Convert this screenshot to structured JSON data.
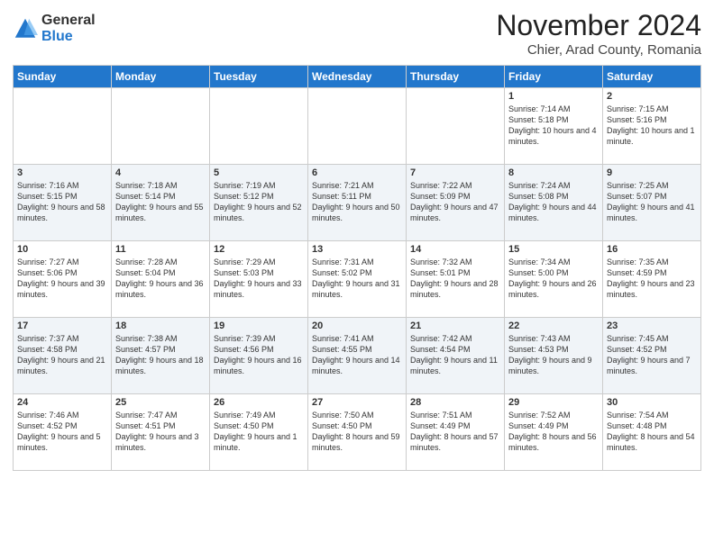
{
  "logo": {
    "general": "General",
    "blue": "Blue"
  },
  "title": "November 2024",
  "subtitle": "Chier, Arad County, Romania",
  "headers": [
    "Sunday",
    "Monday",
    "Tuesday",
    "Wednesday",
    "Thursday",
    "Friday",
    "Saturday"
  ],
  "weeks": [
    [
      {
        "day": "",
        "info": ""
      },
      {
        "day": "",
        "info": ""
      },
      {
        "day": "",
        "info": ""
      },
      {
        "day": "",
        "info": ""
      },
      {
        "day": "",
        "info": ""
      },
      {
        "day": "1",
        "info": "Sunrise: 7:14 AM\nSunset: 5:18 PM\nDaylight: 10 hours and 4 minutes."
      },
      {
        "day": "2",
        "info": "Sunrise: 7:15 AM\nSunset: 5:16 PM\nDaylight: 10 hours and 1 minute."
      }
    ],
    [
      {
        "day": "3",
        "info": "Sunrise: 7:16 AM\nSunset: 5:15 PM\nDaylight: 9 hours and 58 minutes."
      },
      {
        "day": "4",
        "info": "Sunrise: 7:18 AM\nSunset: 5:14 PM\nDaylight: 9 hours and 55 minutes."
      },
      {
        "day": "5",
        "info": "Sunrise: 7:19 AM\nSunset: 5:12 PM\nDaylight: 9 hours and 52 minutes."
      },
      {
        "day": "6",
        "info": "Sunrise: 7:21 AM\nSunset: 5:11 PM\nDaylight: 9 hours and 50 minutes."
      },
      {
        "day": "7",
        "info": "Sunrise: 7:22 AM\nSunset: 5:09 PM\nDaylight: 9 hours and 47 minutes."
      },
      {
        "day": "8",
        "info": "Sunrise: 7:24 AM\nSunset: 5:08 PM\nDaylight: 9 hours and 44 minutes."
      },
      {
        "day": "9",
        "info": "Sunrise: 7:25 AM\nSunset: 5:07 PM\nDaylight: 9 hours and 41 minutes."
      }
    ],
    [
      {
        "day": "10",
        "info": "Sunrise: 7:27 AM\nSunset: 5:06 PM\nDaylight: 9 hours and 39 minutes."
      },
      {
        "day": "11",
        "info": "Sunrise: 7:28 AM\nSunset: 5:04 PM\nDaylight: 9 hours and 36 minutes."
      },
      {
        "day": "12",
        "info": "Sunrise: 7:29 AM\nSunset: 5:03 PM\nDaylight: 9 hours and 33 minutes."
      },
      {
        "day": "13",
        "info": "Sunrise: 7:31 AM\nSunset: 5:02 PM\nDaylight: 9 hours and 31 minutes."
      },
      {
        "day": "14",
        "info": "Sunrise: 7:32 AM\nSunset: 5:01 PM\nDaylight: 9 hours and 28 minutes."
      },
      {
        "day": "15",
        "info": "Sunrise: 7:34 AM\nSunset: 5:00 PM\nDaylight: 9 hours and 26 minutes."
      },
      {
        "day": "16",
        "info": "Sunrise: 7:35 AM\nSunset: 4:59 PM\nDaylight: 9 hours and 23 minutes."
      }
    ],
    [
      {
        "day": "17",
        "info": "Sunrise: 7:37 AM\nSunset: 4:58 PM\nDaylight: 9 hours and 21 minutes."
      },
      {
        "day": "18",
        "info": "Sunrise: 7:38 AM\nSunset: 4:57 PM\nDaylight: 9 hours and 18 minutes."
      },
      {
        "day": "19",
        "info": "Sunrise: 7:39 AM\nSunset: 4:56 PM\nDaylight: 9 hours and 16 minutes."
      },
      {
        "day": "20",
        "info": "Sunrise: 7:41 AM\nSunset: 4:55 PM\nDaylight: 9 hours and 14 minutes."
      },
      {
        "day": "21",
        "info": "Sunrise: 7:42 AM\nSunset: 4:54 PM\nDaylight: 9 hours and 11 minutes."
      },
      {
        "day": "22",
        "info": "Sunrise: 7:43 AM\nSunset: 4:53 PM\nDaylight: 9 hours and 9 minutes."
      },
      {
        "day": "23",
        "info": "Sunrise: 7:45 AM\nSunset: 4:52 PM\nDaylight: 9 hours and 7 minutes."
      }
    ],
    [
      {
        "day": "24",
        "info": "Sunrise: 7:46 AM\nSunset: 4:52 PM\nDaylight: 9 hours and 5 minutes."
      },
      {
        "day": "25",
        "info": "Sunrise: 7:47 AM\nSunset: 4:51 PM\nDaylight: 9 hours and 3 minutes."
      },
      {
        "day": "26",
        "info": "Sunrise: 7:49 AM\nSunset: 4:50 PM\nDaylight: 9 hours and 1 minute."
      },
      {
        "day": "27",
        "info": "Sunrise: 7:50 AM\nSunset: 4:50 PM\nDaylight: 8 hours and 59 minutes."
      },
      {
        "day": "28",
        "info": "Sunrise: 7:51 AM\nSunset: 4:49 PM\nDaylight: 8 hours and 57 minutes."
      },
      {
        "day": "29",
        "info": "Sunrise: 7:52 AM\nSunset: 4:49 PM\nDaylight: 8 hours and 56 minutes."
      },
      {
        "day": "30",
        "info": "Sunrise: 7:54 AM\nSunset: 4:48 PM\nDaylight: 8 hours and 54 minutes."
      }
    ]
  ]
}
